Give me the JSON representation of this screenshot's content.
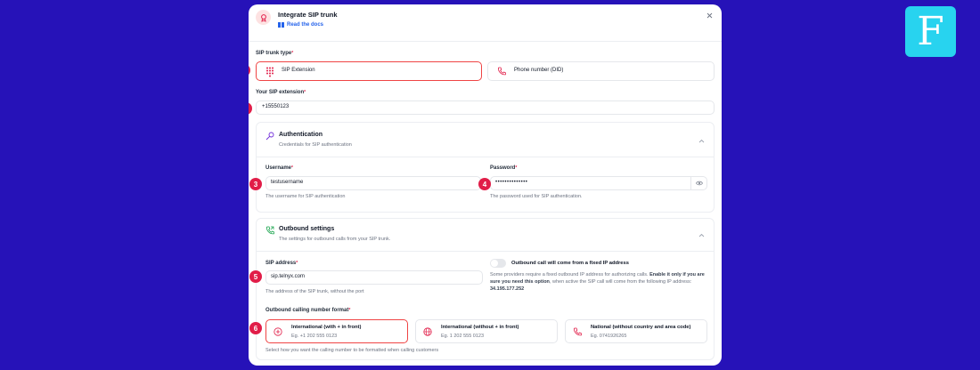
{
  "modal": {
    "title": "Integrate SIP trunk",
    "docs_link": "Read the docs"
  },
  "trunk_type": {
    "label": "SIP trunk type",
    "required_mark": "*",
    "options": [
      "SIP Extension",
      "Phone number (DID)"
    ],
    "selected": "SIP Extension"
  },
  "extension": {
    "label": "Your SIP extension",
    "value": "+15550123"
  },
  "authentication": {
    "title": "Authentication",
    "subtitle": "Credentials for SIP authentication",
    "username_label": "Username",
    "username_value": "testusername",
    "username_help": "The username for SIP authentication",
    "password_label": "Password",
    "password_value": "••••••••••••••",
    "password_help": "The password used for SIP authentication."
  },
  "outbound": {
    "title": "Outbound settings",
    "subtitle": "The settings for outbound calls from your SIP trunk.",
    "sip_address_label": "SIP address",
    "sip_address_value": "sip.telnyx.com",
    "sip_address_help": "The address of the SIP trunk, without the port",
    "fixed_ip_label": "Outbound call will come from a fixed IP address",
    "fixed_ip_enabled": false,
    "fixed_ip_note_1": "Some providers require a fixed outbound IP address for authorizing calls.",
    "fixed_ip_note_bold": "Enable it only if you are sure you need this option",
    "fixed_ip_note_2": ", when active the SIP call will come from the following IP address:",
    "fixed_ip_address": "34.195.177.252",
    "format_label": "Outbound calling number format",
    "format_options": [
      {
        "title": "International (with + in front)",
        "example": "Eg. +1 202 555 0123"
      },
      {
        "title": "International (without + in front)",
        "example": "Eg. 1 202 555 0123"
      },
      {
        "title": "National (without country and area code)",
        "example": "Eg. 0741926265"
      }
    ],
    "format_selected": "International (with + in front)",
    "format_help": "Select how you want the calling number to be formatted when calling customers"
  },
  "markers": [
    "1",
    "2",
    "3",
    "4",
    "5",
    "6"
  ],
  "brand": {
    "logo_letter": "F",
    "accent": "#ef4444",
    "background": "#2612b8"
  }
}
